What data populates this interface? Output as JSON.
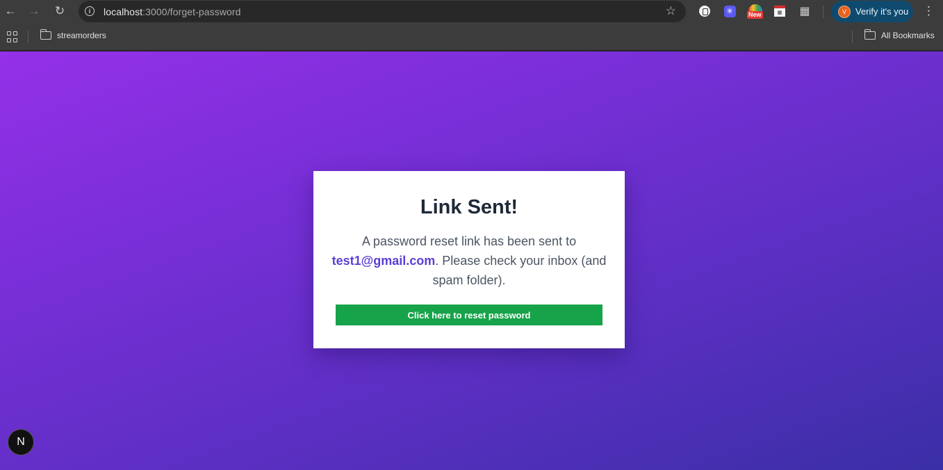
{
  "browser": {
    "url_host": "localhost",
    "url_path": ":3000/forget-password",
    "profile_initial": "V",
    "profile_label": "Verify it's you",
    "extension_badge": "New"
  },
  "bookmarks": {
    "items": [
      {
        "label": "streamorders"
      }
    ],
    "all_bookmarks_label": "All Bookmarks"
  },
  "card": {
    "title": "Link Sent!",
    "message_before": "A password reset link has been sent to ",
    "email": "test1@gmail.com",
    "message_after": ". Please check your inbox (and spam folder).",
    "button_label": "Click here to reset password"
  },
  "dev_badge": {
    "label": "N"
  },
  "colors": {
    "accent": "#5b3fd6",
    "button": "#16a34a",
    "bg_from": "#9430e8",
    "bg_to": "#3a2fa6"
  }
}
